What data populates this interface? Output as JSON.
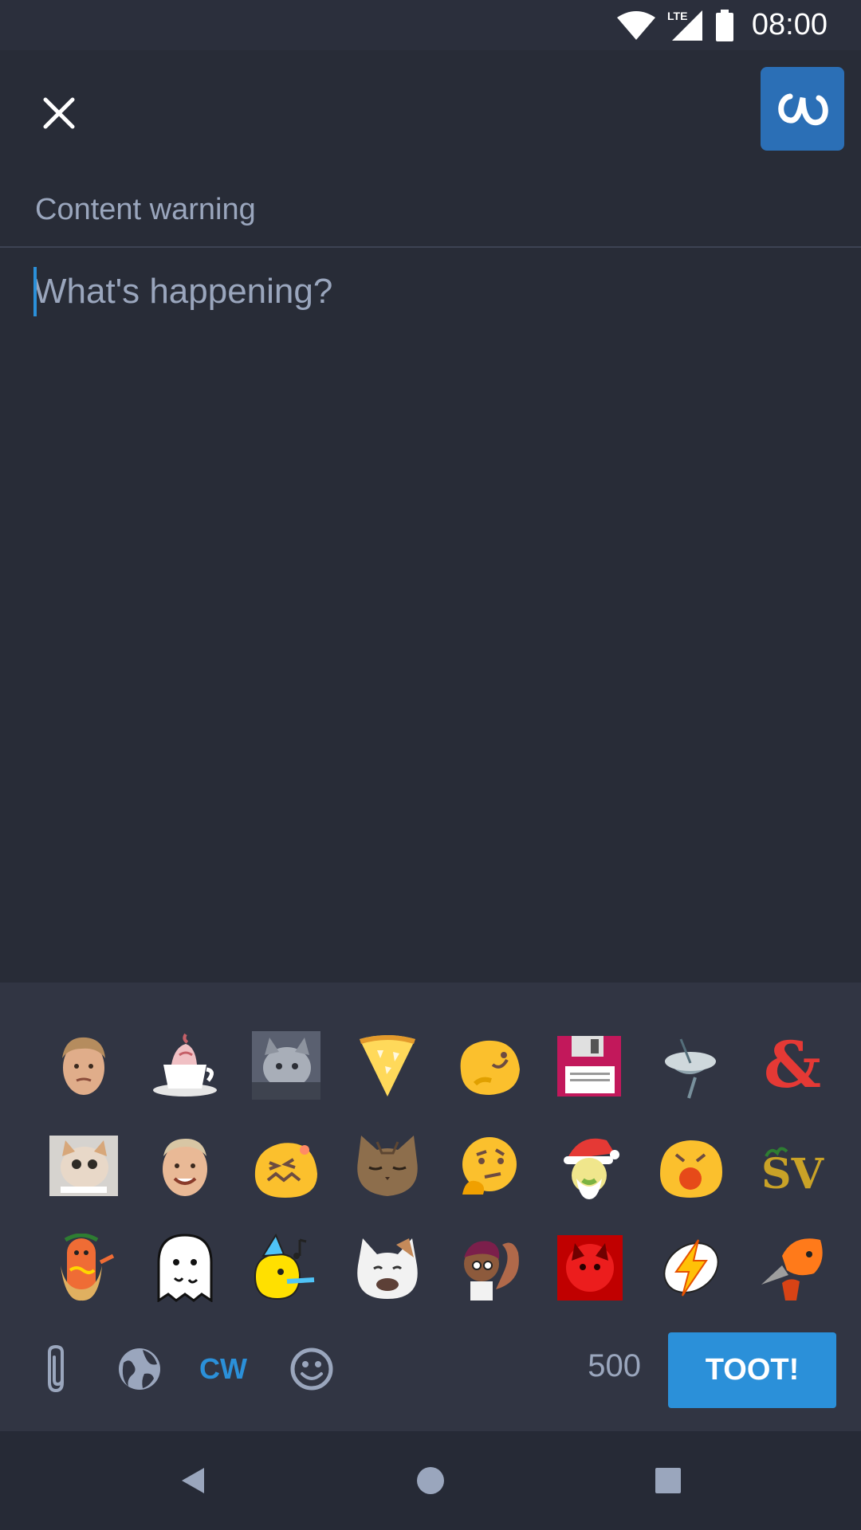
{
  "status_bar": {
    "time": "08:00",
    "network": "LTE"
  },
  "app_bar": {
    "close_icon": "close-icon",
    "account_icon": "mastodon-logo-icon"
  },
  "compose": {
    "cw_placeholder": "Content warning",
    "text_placeholder": "What's happening?"
  },
  "emoji_picker": {
    "emojis": [
      "man-face",
      "hot-chocolate",
      "grey-cat-photo",
      "pizza-slice",
      "blob-wink",
      "floppy-disk",
      "satellite-dish",
      "ampersand",
      "happy-cat-photo",
      "smiling-man-face",
      "blob-laugh",
      "cat-face",
      "thinking-blob",
      "santa-sick",
      "blob-scream",
      "sv-logo",
      "dancing-hotdog",
      "ghost",
      "party-blob",
      "white-cat",
      "squirrel-girl",
      "red-cat",
      "lightning-badge",
      "squid-kid"
    ]
  },
  "toolbar": {
    "attach_icon": "paperclip-icon",
    "visibility_icon": "globe-icon",
    "cw_label": "CW",
    "emoji_icon": "smiley-icon",
    "char_count": "500",
    "toot_label": "TOOT!"
  },
  "colors": {
    "background": "#282c37",
    "panel": "#313543",
    "accent": "#2b90d9",
    "muted_text": "#9aa6bd"
  }
}
